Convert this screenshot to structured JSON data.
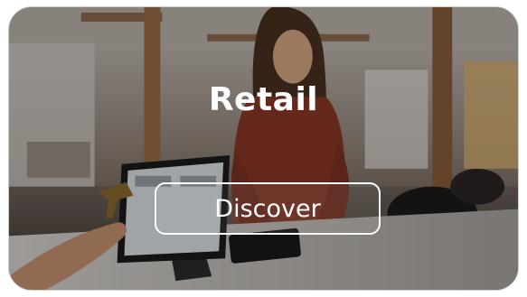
{
  "card": {
    "title": "Retail",
    "button_label": "Discover"
  },
  "colors": {
    "text": "#ffffff",
    "border": "#ffffff"
  }
}
